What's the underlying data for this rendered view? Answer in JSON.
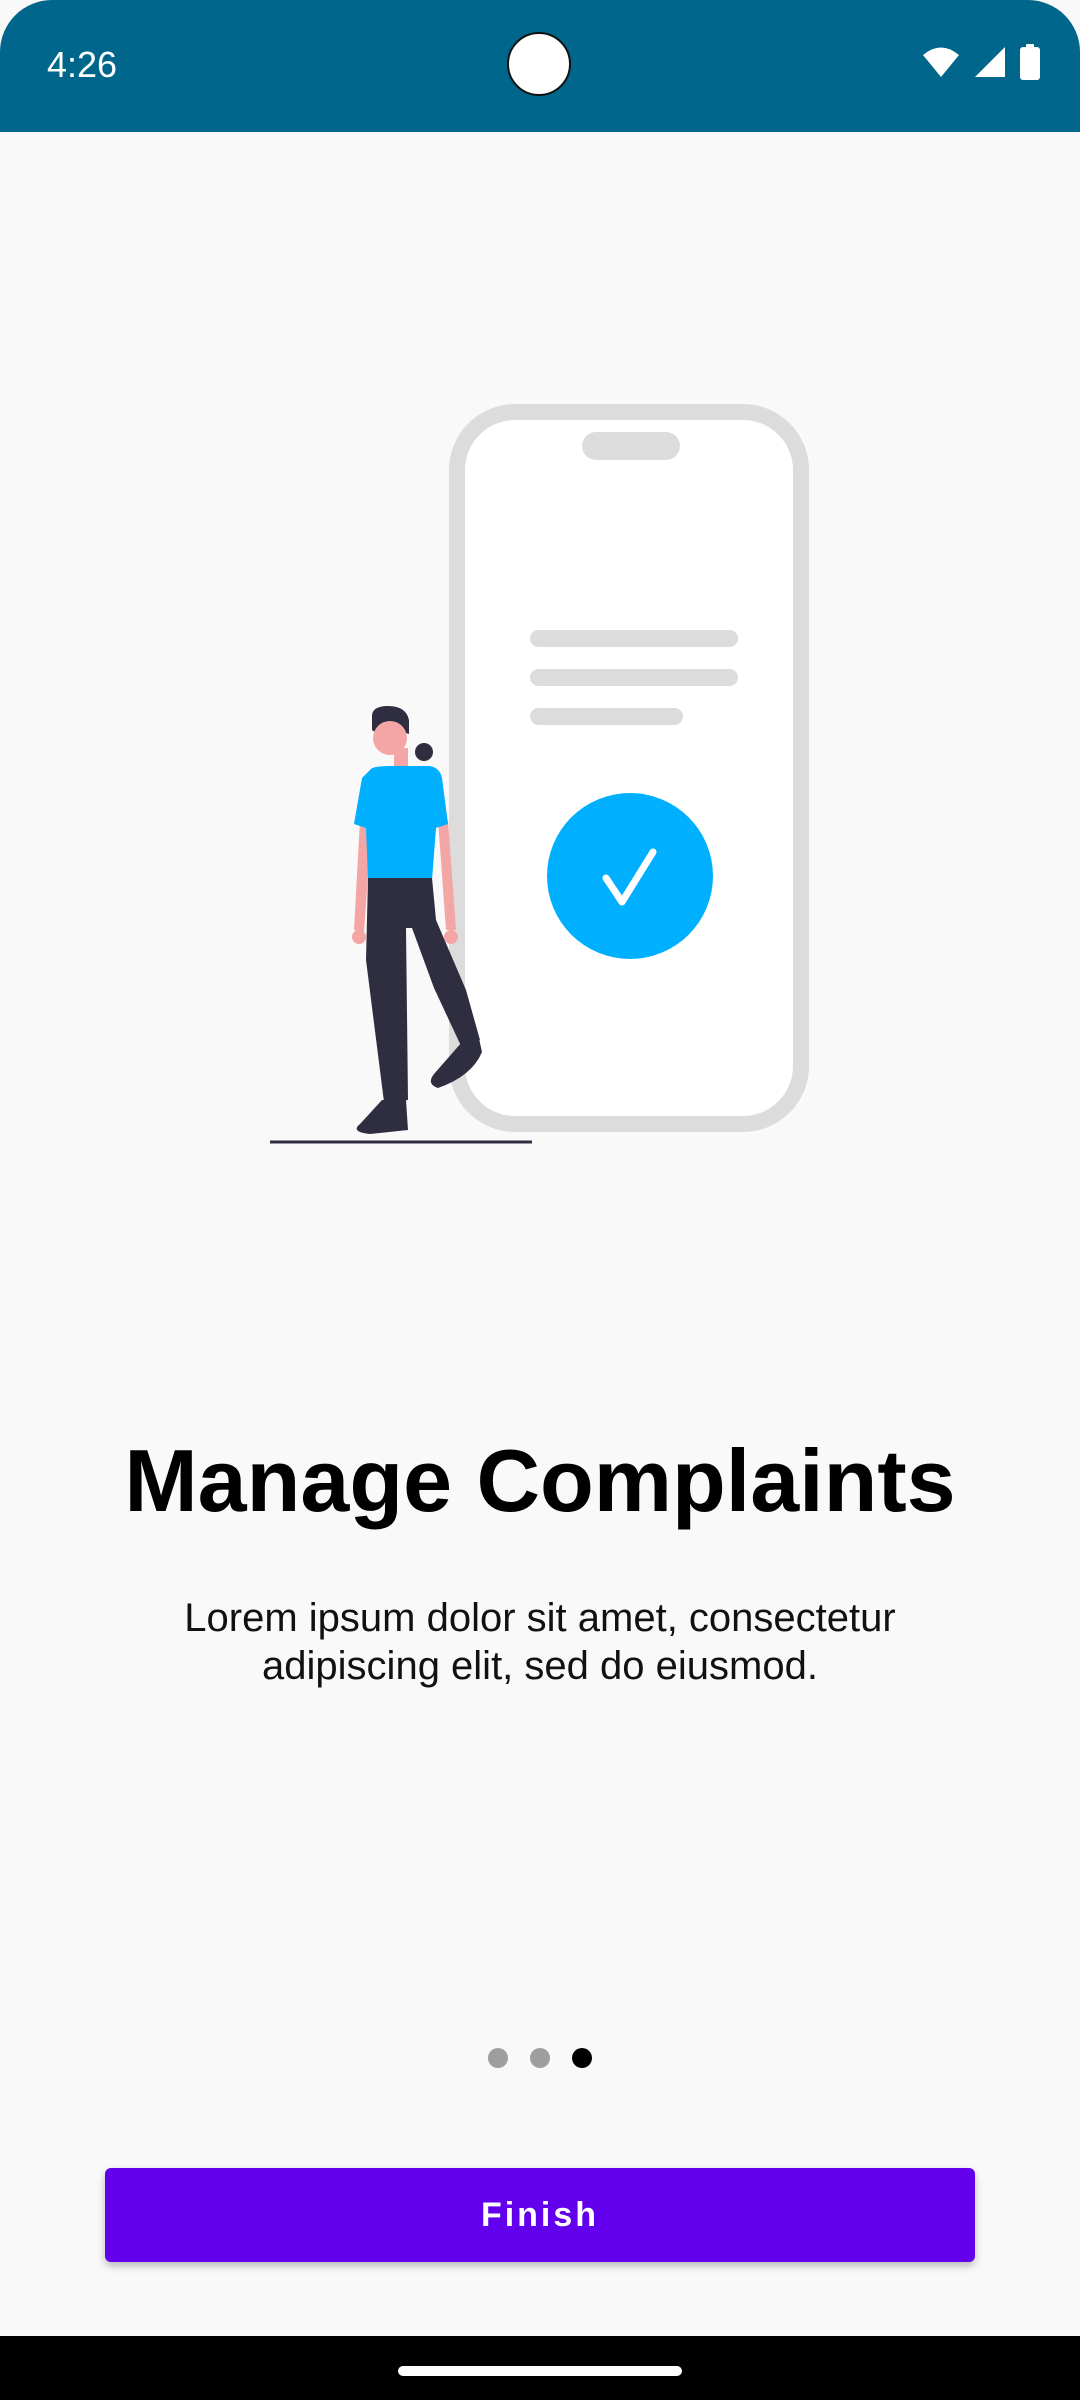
{
  "status_bar": {
    "time": "4:26",
    "icons": [
      "wifi-icon",
      "signal-icon",
      "battery-icon"
    ],
    "background": "#00668c"
  },
  "onboarding": {
    "title": "Manage Complaints",
    "description": "Lorem ipsum dolor sit amet, consectetur adipiscing elit, sed do eiusmod.",
    "page_count": 3,
    "current_page": 3,
    "finish_label": "Finish",
    "accent_color": "#6200ee",
    "illustration_accent": "#00b0ff"
  }
}
